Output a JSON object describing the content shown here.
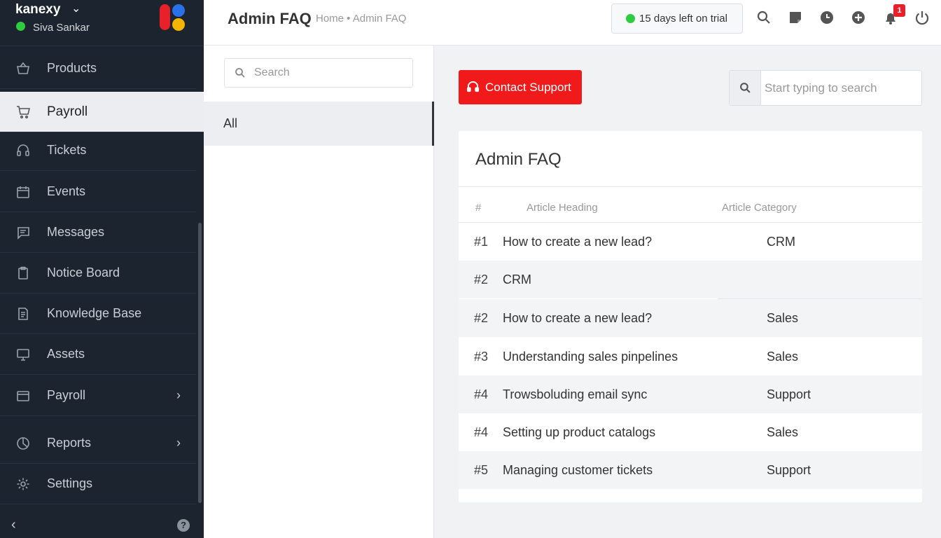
{
  "app": {
    "brand": "kanexy",
    "user_name": "Siva Sankar"
  },
  "sidebar": {
    "items": [
      {
        "label": "Products",
        "icon": "basket-icon"
      },
      {
        "label": "Payroll",
        "icon": "cart-icon",
        "active": true
      },
      {
        "label": "Tickets",
        "icon": "headset-icon"
      },
      {
        "label": "Events",
        "icon": "calendar-icon"
      },
      {
        "label": "Messages",
        "icon": "message-icon"
      },
      {
        "label": "Notice Board",
        "icon": "clipboard-icon"
      },
      {
        "label": "Knowledge Base",
        "icon": "document-icon"
      },
      {
        "label": "Assets",
        "icon": "monitor-icon"
      },
      {
        "label": "Payroll",
        "icon": "wallet-icon",
        "has_submenu": true
      },
      {
        "label": "Reports",
        "icon": "pie-chart-icon",
        "has_submenu": true
      },
      {
        "label": "Settings",
        "icon": "gear-icon"
      }
    ]
  },
  "header": {
    "title": "Admin FAQ",
    "breadcrumb": "Home • Admin FAQ",
    "trial_text": "15 days left on trial",
    "notification_count": "1"
  },
  "categories": {
    "search_placeholder": "Search",
    "items": [
      {
        "label": "All",
        "active": true
      }
    ]
  },
  "main": {
    "contact_label": "Contact Support",
    "search_placeholder": "Start typing to search",
    "card_title": "Admin FAQ",
    "columns": {
      "num": "#",
      "heading": "Article Heading",
      "category": "Article Category"
    },
    "rows": [
      {
        "num": "#1",
        "heading": "How to create a new lead?",
        "category": "CRM"
      },
      {
        "num": "#2",
        "heading": "CRM",
        "category": ""
      },
      {
        "num": "#2",
        "heading": "How to create a new lead?",
        "category": "Sales"
      },
      {
        "num": "#3",
        "heading": "Understanding sales pinpelines",
        "category": "Sales"
      },
      {
        "num": "#4",
        "heading": "Trowsboluding email sync",
        "category": "Support"
      },
      {
        "num": "#4",
        "heading": "Setting up product catalogs",
        "category": "Sales"
      },
      {
        "num": "#5",
        "heading": "Managing customer tickets",
        "category": "Support"
      }
    ]
  },
  "colors": {
    "sidebar_bg": "#1c2430",
    "accent_red": "#f01a1a",
    "online_green": "#2ecc40"
  }
}
